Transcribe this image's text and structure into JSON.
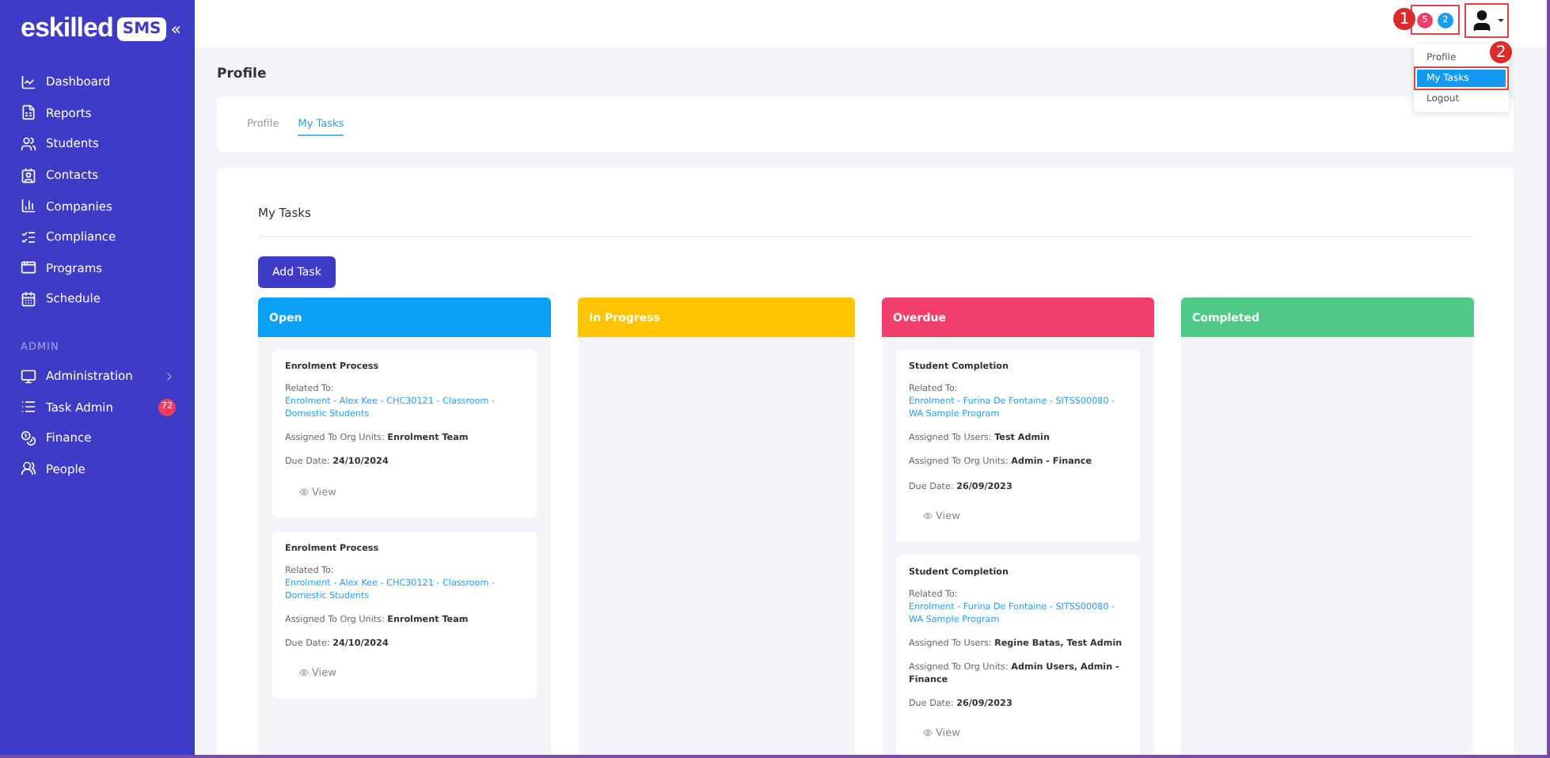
{
  "logo": {
    "word": "eskilled",
    "badge": "SMS",
    "collapse": "«"
  },
  "sidebar": {
    "items": [
      {
        "label": "Dashboard"
      },
      {
        "label": "Reports"
      },
      {
        "label": "Students"
      },
      {
        "label": "Contacts"
      },
      {
        "label": "Companies"
      },
      {
        "label": "Compliance"
      },
      {
        "label": "Programs"
      },
      {
        "label": "Schedule"
      }
    ],
    "section": "ADMIN",
    "admin_items": [
      {
        "label": "Administration",
        "expandable": true
      },
      {
        "label": "Task Admin",
        "expandable": false,
        "badge": "72"
      },
      {
        "label": "Finance",
        "expandable": false
      },
      {
        "label": "People",
        "expandable": false
      }
    ]
  },
  "topbar": {
    "badges": [
      {
        "count": "5",
        "color": "#ef3e66"
      },
      {
        "count": "2",
        "color": "#1a9cf0"
      }
    ]
  },
  "user_menu": {
    "open": true,
    "items": [
      {
        "label": "Profile",
        "selected": false
      },
      {
        "label": "My Tasks",
        "selected": true
      },
      {
        "label": "Logout",
        "selected": false
      }
    ]
  },
  "annotations": [
    {
      "label": "1"
    },
    {
      "label": "2"
    }
  ],
  "page_title": "Profile",
  "tabs": [
    {
      "label": "Profile",
      "selected": false
    },
    {
      "label": "My Tasks",
      "selected": true
    }
  ],
  "panel_title": "My Tasks",
  "add_button": "Add Task",
  "columns": [
    {
      "title": "Open",
      "color": "#0aa0f5",
      "cards": [
        {
          "title": "Enrolment Process",
          "fields": [
            {
              "kind": "link",
              "label": "Related To:",
              "value": "Enrolment - Alex Kee - CHC30121 - Classroom - Domestic Students"
            },
            {
              "kind": "bold",
              "label": "Assigned To Org Units:",
              "value": "Enrolment Team"
            },
            {
              "kind": "bold",
              "label": "Due Date:",
              "value": "24/10/2024"
            }
          ],
          "action": "View"
        },
        {
          "title": "Enrolment Process",
          "fields": [
            {
              "kind": "link",
              "label": "Related To:",
              "value": "Enrolment - Alex Kee - CHC30121 - Classroom - Domestic Students"
            },
            {
              "kind": "bold",
              "label": "Assigned To Org Units:",
              "value": "Enrolment Team"
            },
            {
              "kind": "bold",
              "label": "Due Date:",
              "value": "24/10/2024"
            }
          ],
          "action": "View"
        }
      ]
    },
    {
      "title": "In Progress",
      "color": "#ffc400"
    },
    {
      "title": "Overdue",
      "color": "#f23e6b",
      "cards": [
        {
          "title": "Student Completion",
          "fields": [
            {
              "kind": "link",
              "label": "Related To:",
              "value": "Enrolment - Furina De Fontaine - SITSS00080 - WA Sample Program"
            },
            {
              "kind": "bold",
              "label": "Assigned To Users:",
              "value": "Test Admin"
            },
            {
              "kind": "bold",
              "label": "Assigned To Org Units:",
              "value": "Admin - Finance"
            },
            {
              "kind": "bold",
              "label": "Due Date:",
              "value": "26/09/2023"
            }
          ],
          "action": "View"
        },
        {
          "title": "Student Completion",
          "fields": [
            {
              "kind": "link",
              "label": "Related To:",
              "value": "Enrolment - Furina De Fontaine - SITSS00080 - WA Sample Program"
            },
            {
              "kind": "bold",
              "label": "Assigned To Users:",
              "value": "Regine Batas, Test Admin"
            },
            {
              "kind": "bold",
              "label": "Assigned To Org Units:",
              "value": "Admin Users, Admin - Finance"
            },
            {
              "kind": "bold",
              "label": "Due Date:",
              "value": "26/09/2023"
            }
          ],
          "action": "View"
        }
      ]
    },
    {
      "title": "Completed",
      "color": "#4fca86"
    }
  ]
}
